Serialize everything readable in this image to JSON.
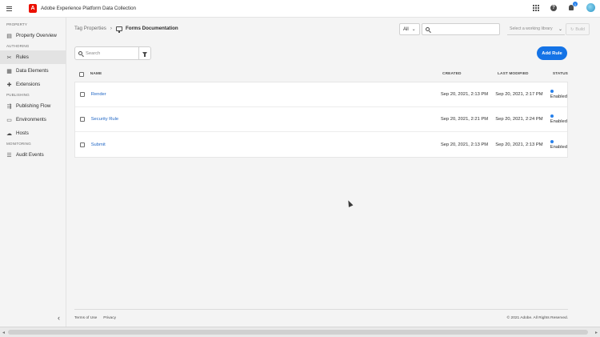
{
  "app": {
    "logo_letter": "A",
    "title": "Adobe Experience Platform Data Collection",
    "notification_count": "1"
  },
  "sidebar": {
    "sections": [
      {
        "heading": "PROPERTY",
        "items": [
          {
            "label": "Property Overview",
            "icon": "property-icon"
          }
        ]
      },
      {
        "heading": "AUTHORING",
        "items": [
          {
            "label": "Rules",
            "icon": "rules-icon",
            "active": true
          },
          {
            "label": "Data Elements",
            "icon": "data-elements-icon"
          },
          {
            "label": "Extensions",
            "icon": "extensions-icon"
          }
        ]
      },
      {
        "heading": "PUBLISHING",
        "items": [
          {
            "label": "Publishing Flow",
            "icon": "publishing-flow-icon"
          },
          {
            "label": "Environments",
            "icon": "environments-icon"
          },
          {
            "label": "Hosts",
            "icon": "hosts-icon"
          }
        ]
      },
      {
        "heading": "MONITORING",
        "items": [
          {
            "label": "Audit Events",
            "icon": "audit-events-icon"
          }
        ]
      }
    ]
  },
  "breadcrumb": {
    "parent": "Tag Properties",
    "separator": "›",
    "current": "Forms Documentation"
  },
  "toolbar": {
    "filter_value": "All",
    "search_placeholder": "",
    "library_placeholder": "Select a working library",
    "build_label": "Build"
  },
  "rules_search": {
    "placeholder": "Search"
  },
  "add_rule_label": "Add Rule",
  "table": {
    "columns": {
      "name": "NAME",
      "created": "CREATED",
      "modified": "LAST MODIFIED",
      "status": "STATUS"
    },
    "rows": [
      {
        "name": "Render",
        "created": "Sep 20, 2021, 2:13 PM",
        "modified": "Sep 20, 2021, 2:17 PM",
        "status": "Enabled"
      },
      {
        "name": "Security Rule",
        "created": "Sep 20, 2021, 2:21 PM",
        "modified": "Sep 20, 2021, 2:24 PM",
        "status": "Enabled"
      },
      {
        "name": "Submit",
        "created": "Sep 20, 2021, 2:13 PM",
        "modified": "Sep 20, 2021, 2:13 PM",
        "status": "Enabled"
      }
    ]
  },
  "footer": {
    "terms": "Terms of Use",
    "privacy": "Privacy",
    "copyright": "© 2021 Adobe. All Rights Reserved."
  },
  "colors": {
    "accent": "#1473e6",
    "brand": "#eb1000",
    "status_enabled": "#2680eb"
  }
}
